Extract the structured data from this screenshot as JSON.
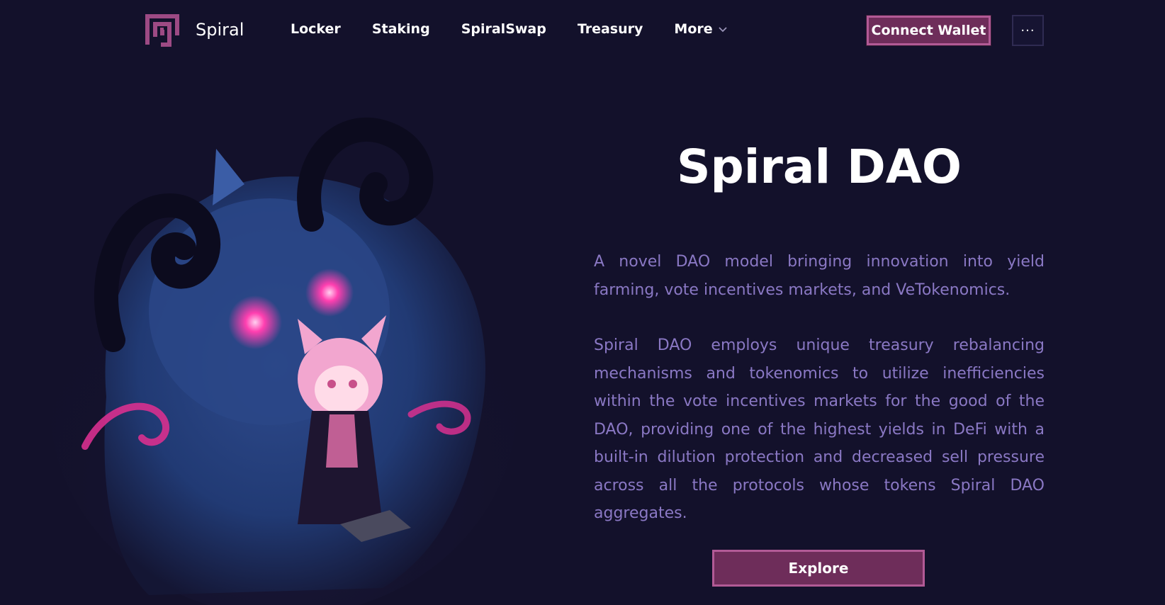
{
  "header": {
    "brand": "Spiral",
    "nav": [
      {
        "label": "Locker"
      },
      {
        "label": "Staking"
      },
      {
        "label": "SpiralSwap"
      },
      {
        "label": "Treasury"
      },
      {
        "label": "More"
      }
    ],
    "connect_label": "Connect Wallet",
    "more_menu_label": "···"
  },
  "hero": {
    "title": "Spiral DAO",
    "paragraph1": "A novel DAO model bringing innovation into yield farming, vote incentives markets, and VeTokenomics.",
    "paragraph2": "Spiral DAO employs unique treasury rebalancing mechanisms and tokenomics to utilize inefficiencies within the vote incentives markets for the good of the DAO, providing one of the highest yields in DeFi with a built-in dilution protection and decreased sell pressure across all the protocols whose tokens Spiral DAO aggregates.",
    "explore_label": "Explore"
  },
  "colors": {
    "background": "#13112b",
    "accent": "#6e2d5a",
    "accent_border": "#b25a96",
    "body_text": "#8a78c4"
  },
  "icons": {
    "logo": "spiral-square-logo-icon",
    "more_chevron": "chevron-down-icon"
  }
}
